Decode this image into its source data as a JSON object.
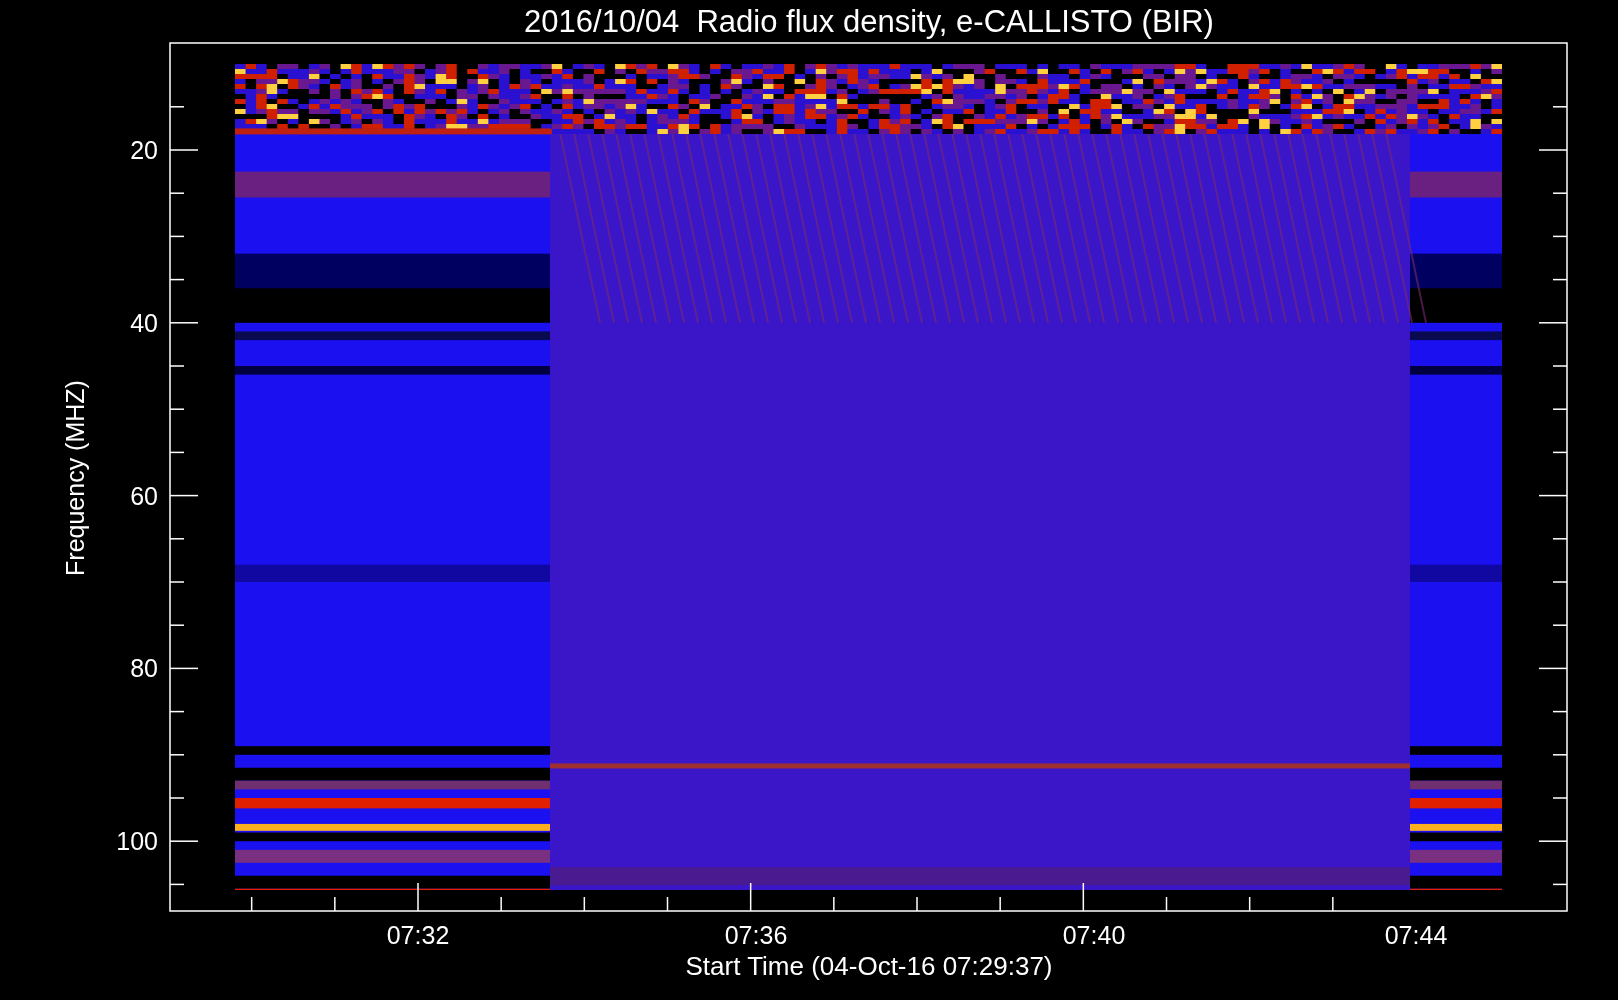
{
  "title": "2016/10/04  Radio flux density, e-CALLISTO (BIR)",
  "y_axis": {
    "label": "Frequency (MHZ)",
    "ticks": [
      "20",
      "40",
      "60",
      "80",
      "100"
    ]
  },
  "x_axis": {
    "label": "Start Time (04-Oct-16 07:29:37)",
    "ticks": [
      "07:32",
      "07:36",
      "07:40",
      "07:44"
    ]
  }
}
